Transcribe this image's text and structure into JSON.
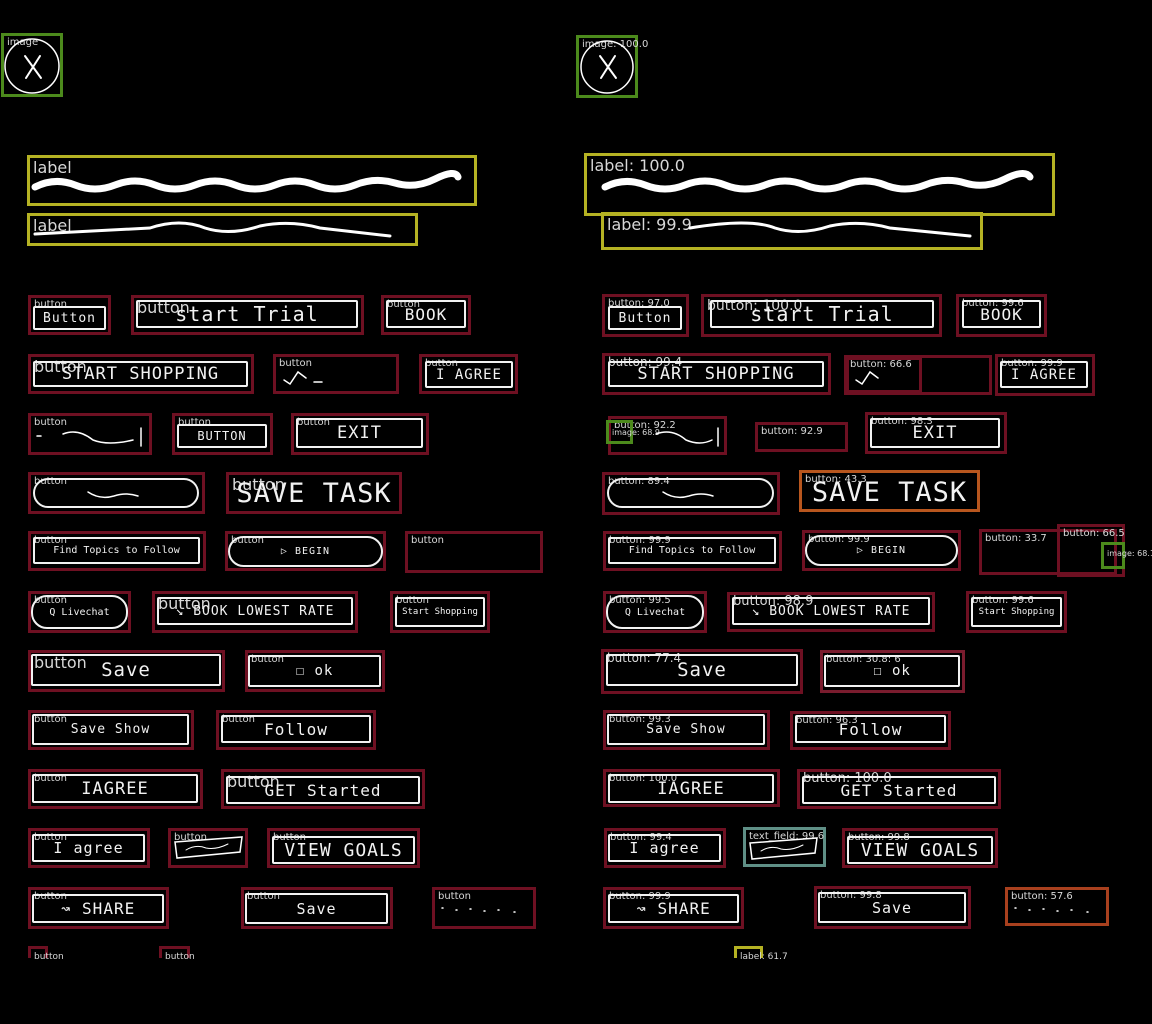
{
  "panels": {
    "left": {
      "image_label": "image",
      "label_1": "label",
      "label_2": "label",
      "button_label": "button"
    },
    "right": {
      "image_label": "image: 100.0",
      "label_1": "label: 100.0",
      "label_2": "label: 99.9",
      "bottom_label": "label: 61.7",
      "scores": {
        "button_1": "button: 97.0",
        "start_trial": "button: 100.0",
        "book": "button: 99.6",
        "start_shopping": "button: 99.4",
        "checkmark_button": "button: 66.6",
        "i_agree_1": "button: 99.9",
        "wave_button": "button: 92.2",
        "wave_image": "image: 68.9",
        "button_2": "button: 92.9",
        "exit": "button: 98.3",
        "oval_button": "button: 89.4",
        "save_task": "button: 43.3",
        "find_topics": "button: 99.9",
        "begin": "button: 99.9",
        "empty_a": "button: 33.7",
        "empty_b": "button: 66.5",
        "empty_image": "image: 68.1",
        "live_chat": "button: 99.5",
        "book_lowest_rate": "button: 98.9",
        "start_shopping_small": "button: 99.6",
        "save_1": "button: 77.4",
        "ok": "button: 30.8: 6",
        "save_show": "button: 99.3",
        "follow": "button: 96.3",
        "i_agree_2": "button: 100.0",
        "get_started": "button: 100.0",
        "i_agree_3": "button: 99.4",
        "scribble_field": "text_field: 99.6",
        "view_goals": "button: 99.8",
        "share": "button: 99.9",
        "save_2": "button: 99.8",
        "dots_button": "button: 57.6"
      }
    }
  },
  "sketch_text": {
    "button": "Button",
    "start_trial": "start Trial",
    "book": "BOOK",
    "start_shopping": "START SHOPPING",
    "i_agree": "I AGREE",
    "button_caps": "BUTTON",
    "exit": "EXIT",
    "save_task": "SAVE TASK",
    "find_topics": "Find Topics to Follow",
    "begin": "▷ BEGIN",
    "live_chat": "Q Livechat",
    "book_lowest_rate": "↘ BOOK LOWEST RATE",
    "start_shopping_small": "Start Shopping",
    "save": "Save",
    "ok": "☐ ok",
    "save_show": "Save Show",
    "follow": "Follow",
    "i_agree_title": "IAGREE",
    "get_started": "GET Started",
    "i_agree_lower": "I agree",
    "view_goals": "VIEW GOALS",
    "share": "↝ SHARE",
    "save_2": "Save"
  },
  "icons": {
    "close_icon": "close-icon"
  },
  "colors": {
    "background": "#000000",
    "button_box": "#6e1022",
    "label_box": "#b5b223",
    "image_box": "#4c8a1c",
    "text_field_box": "#5f8f86",
    "low_score_box": "#b8561e",
    "sketch_stroke": "#f2f2f2"
  }
}
